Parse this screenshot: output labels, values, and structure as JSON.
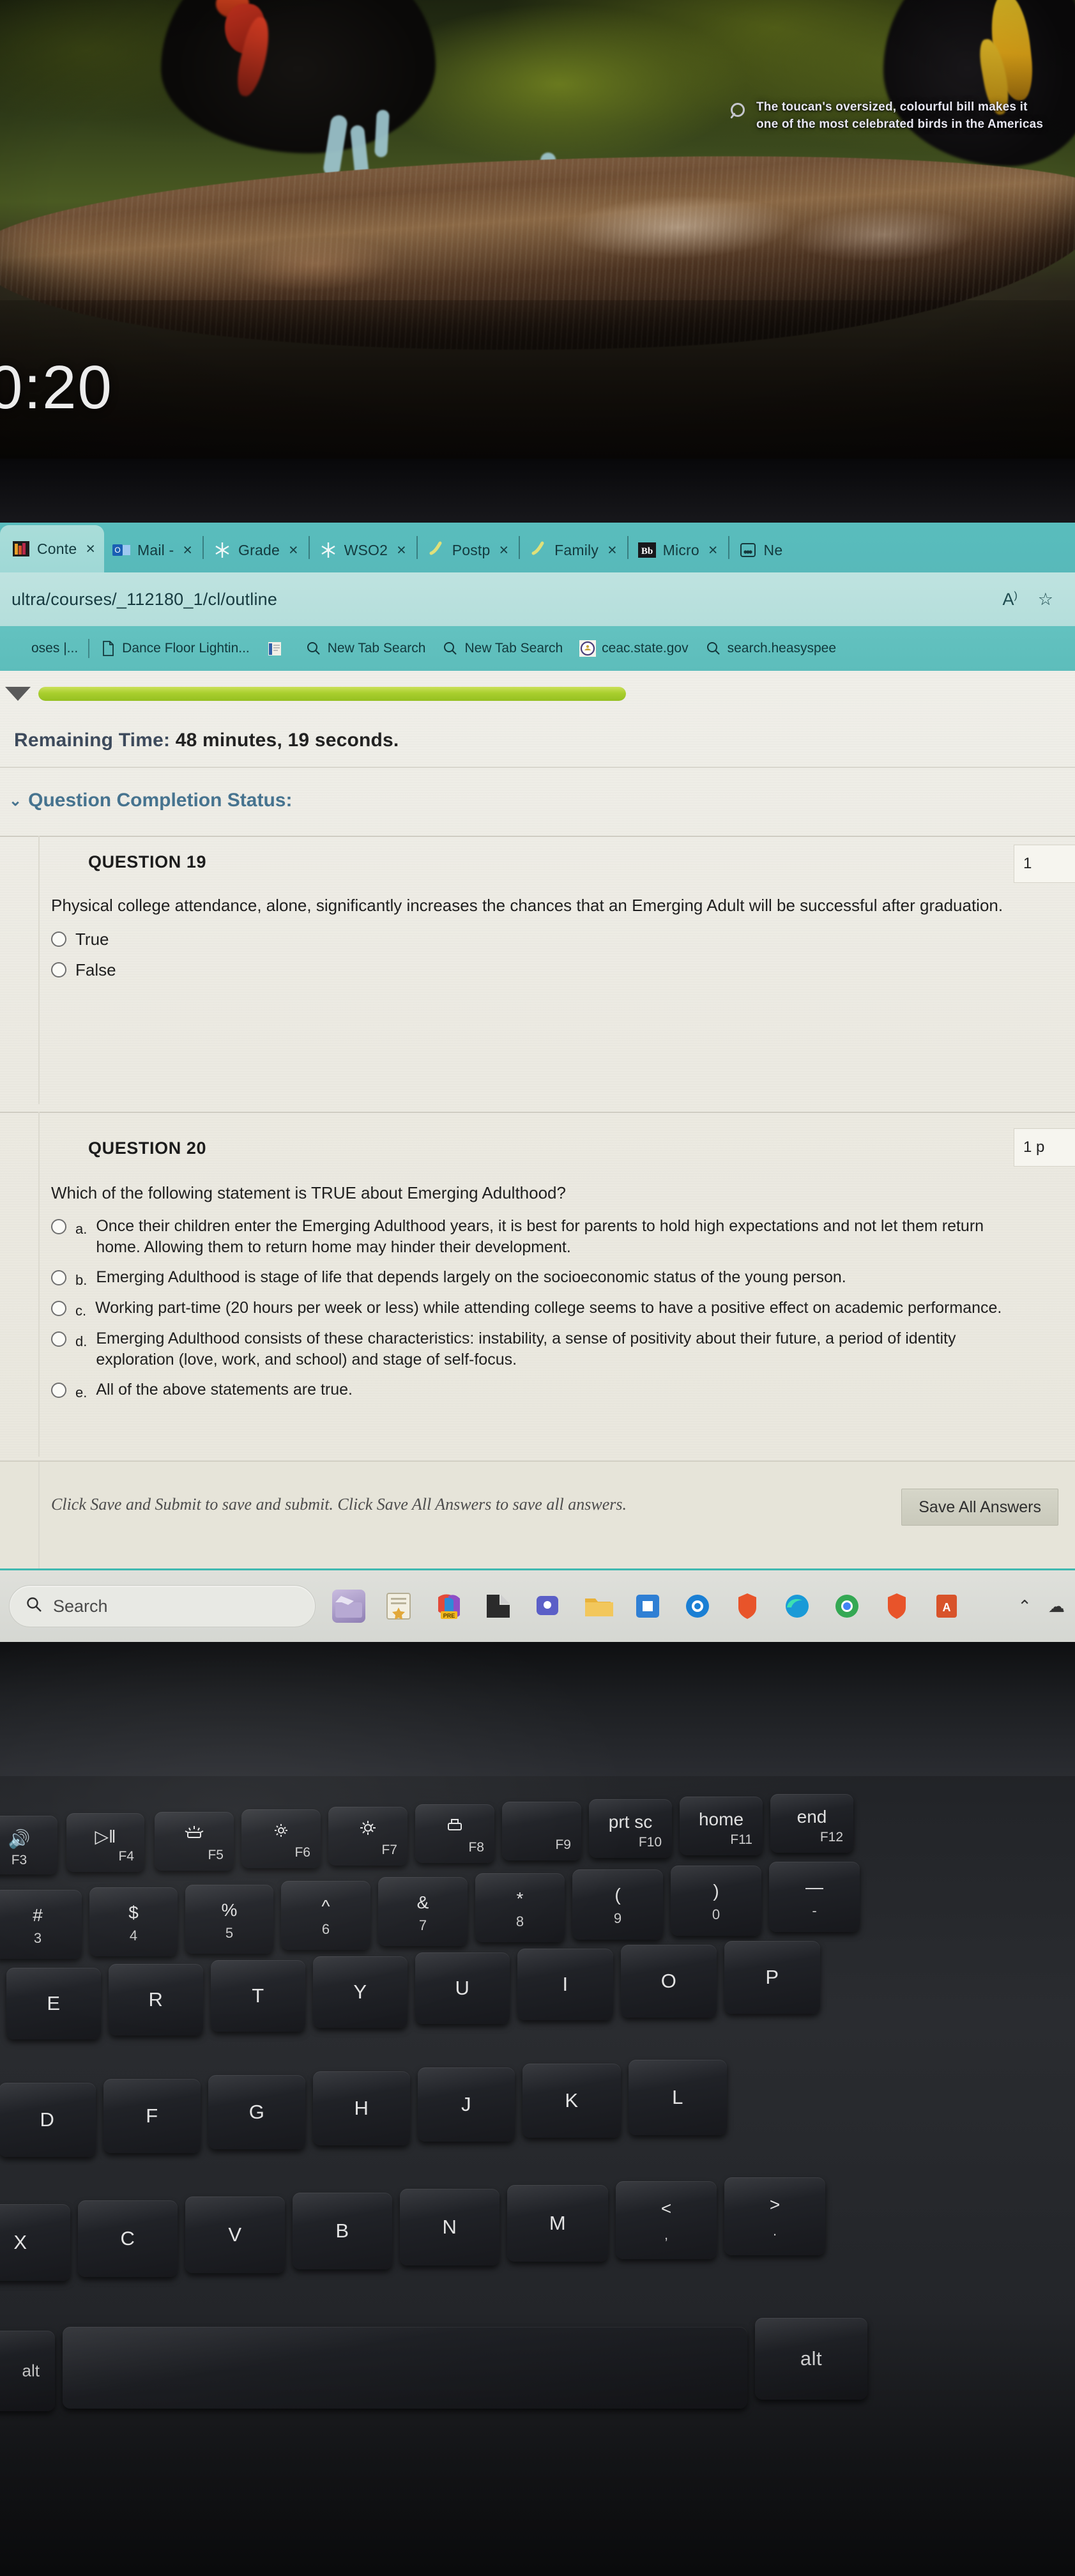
{
  "lockscreen": {
    "clock": "0:20",
    "spotlight_icon": "search-icon",
    "spotlight_text": "The toucan's oversized, colourful bill makes it one of the most celebrated birds in the Americas"
  },
  "browser": {
    "tabs": [
      {
        "label": "Conte",
        "favicon": "book-icon",
        "close": "×",
        "active": true
      },
      {
        "label": "Mail -",
        "favicon": "outlook-icon",
        "close": "×",
        "active": false
      },
      {
        "label": "Grade",
        "favicon": "snowflake-icon",
        "close": "×",
        "active": false
      },
      {
        "label": "WSO2",
        "favicon": "snowflake-icon",
        "close": "×",
        "active": false
      },
      {
        "label": "Postp",
        "favicon": "postman-icon",
        "close": "×",
        "active": false
      },
      {
        "label": "Family",
        "favicon": "postman-icon",
        "close": "×",
        "active": false
      },
      {
        "label": "Micro",
        "favicon": "blackboard-icon",
        "close": "×",
        "active": false
      },
      {
        "label": "Ne",
        "favicon": "newtab-icon",
        "close": "",
        "active": false
      }
    ],
    "url": "ultra/courses/_112180_1/cl/outline",
    "url_read_aloud_icon": "read-aloud-icon",
    "url_favorite_icon": "star-icon",
    "bookmarks": [
      {
        "label": "oses |...",
        "icon": "generic-icon"
      },
      {
        "label": "Dance Floor Lightin...",
        "icon": "page-icon"
      },
      {
        "label": "",
        "icon": "doc-icon"
      },
      {
        "label": "New Tab Search",
        "icon": "search-icon"
      },
      {
        "label": "New Tab Search",
        "icon": "search-icon"
      },
      {
        "label": "ceac.state.gov",
        "icon": "seal-icon"
      },
      {
        "label": "search.heasyspee",
        "icon": "search-icon"
      }
    ]
  },
  "test": {
    "progress_percent": 100,
    "remaining_label": "Remaining Time:",
    "remaining_value": "48 minutes, 19 seconds.",
    "completion_status_label": "Question Completion Status:",
    "questions": [
      {
        "title": "QUESTION 19",
        "points": "1",
        "text": "Physical college attendance, alone, significantly increases the chances that an Emerging Adult will be successful after graduation.",
        "options": [
          {
            "letter": "",
            "text": "True"
          },
          {
            "letter": "",
            "text": "False"
          }
        ]
      },
      {
        "title": "QUESTION 20",
        "points": "1 p",
        "text": "Which of the following statement is TRUE about Emerging Adulthood?",
        "options": [
          {
            "letter": "a.",
            "text": "Once their children enter the Emerging Adulthood years, it is best for parents to hold high expectations and not let them return home.  Allowing them to return home may hinder their development."
          },
          {
            "letter": "b.",
            "text": "Emerging Adulthood is stage of life that depends largely on the socioeconomic status of the young person."
          },
          {
            "letter": "c.",
            "text": "Working part-time (20 hours per week or less) while attending college seems to have a positive effect on academic performance."
          },
          {
            "letter": "d.",
            "text": "Emerging Adulthood consists of these characteristics: instability, a sense of positivity about their future, a period of identity exploration (love, work, and school) and stage of self-focus."
          },
          {
            "letter": "e.",
            "text": "All of the above statements are true."
          }
        ]
      }
    ],
    "footer_note": "Click Save and Submit to save and submit. Click Save All Answers to save all answers.",
    "save_all_button": "Save All Answers"
  },
  "taskbar": {
    "search_placeholder": "Search",
    "search_icon": "search-icon",
    "icons": [
      "clapperboard-icon",
      "notes-icon",
      "office-icon",
      "explorer-icon",
      "teams-icon",
      "folder-icon",
      "store-icon",
      "outlook-blue-icon",
      "brave-icon",
      "edge-icon",
      "chrome-icon",
      "brave2-icon",
      "acrobat-icon"
    ],
    "overflow_caret": "⌃",
    "tray_icon": "cloud-icon"
  },
  "keyboard": {
    "function_row": [
      {
        "top": "🔊",
        "label": "F3"
      },
      {
        "top": "▷‖",
        "label": "F4"
      },
      {
        "top": "kbd-backlight",
        "label": "F5"
      },
      {
        "top": "brightness-down",
        "label": "F6"
      },
      {
        "top": "brightness-up",
        "label": "F7"
      },
      {
        "top": "print-screen-icon",
        "label": "F8"
      },
      {
        "top": "",
        "label": "F9"
      },
      {
        "top": "prt sc",
        "label": "F10"
      },
      {
        "top": "home",
        "label": "F11"
      },
      {
        "top": "end",
        "label": "F12"
      }
    ],
    "number_row": [
      {
        "top": "#",
        "bottom": "3"
      },
      {
        "top": "$",
        "bottom": "4"
      },
      {
        "top": "%",
        "bottom": "5"
      },
      {
        "top": "^",
        "bottom": "6"
      },
      {
        "top": "&",
        "bottom": "7"
      },
      {
        "top": "*",
        "bottom": "8"
      },
      {
        "top": "(",
        "bottom": "9"
      },
      {
        "top": ")",
        "bottom": "0"
      },
      {
        "top": "—",
        "bottom": "-"
      }
    ],
    "row_q": [
      "E",
      "R",
      "T",
      "Y",
      "U",
      "I",
      "O",
      "P"
    ],
    "row_a": [
      "D",
      "F",
      "G",
      "H",
      "J",
      "K",
      "L"
    ],
    "row_z": [
      "X",
      "C",
      "V",
      "B",
      "N",
      "M"
    ],
    "row_z_extra": [
      {
        "top": "<",
        "bottom": ","
      },
      {
        "top": ">",
        "bottom": "."
      }
    ],
    "alt_key": "alt",
    "alt_left_key": "alt"
  }
}
